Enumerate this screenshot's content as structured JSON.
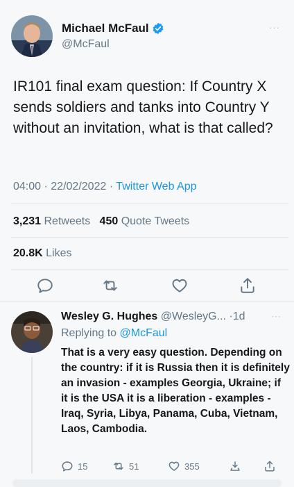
{
  "tweet": {
    "author_name": "Michael McFaul",
    "author_handle": "@McFaul",
    "text": "IR101 final exam question: If Country X sends soldiers and tanks into Country Y without an invitation, what is that called?",
    "time": "04:00",
    "date": "22/02/2022",
    "app": "Twitter Web App",
    "retweets_count": "3,231",
    "retweets_label": "Retweets",
    "quote_count": "450",
    "quote_label": "Quote Tweets",
    "likes_count": "20.8K",
    "likes_label": "Likes",
    "more_icon": "···",
    "verified_color": "#1d9bf0"
  },
  "reply": {
    "author_name": "Wesley G. Hughes",
    "author_handle": "@WesleyG...",
    "age": "1d",
    "replying_prefix": "Replying to",
    "replying_to": "@McFaul",
    "text": "That is a very easy question. Depending on the country: if it is Russia then it is definitely an invasion - examples Georgia, Ukraine; if it is the USA it is a liberation - examples - Iraq, Syria, Libya, Panama, Cuba, Vietnam, Laos, Cambodia.",
    "reply_count": "15",
    "retweet_count": "51",
    "like_count": "355",
    "more_icon": "···"
  },
  "colors": {
    "link": "#1b95e0",
    "secondary_text": "#657786",
    "background": "#f7f8f9"
  }
}
